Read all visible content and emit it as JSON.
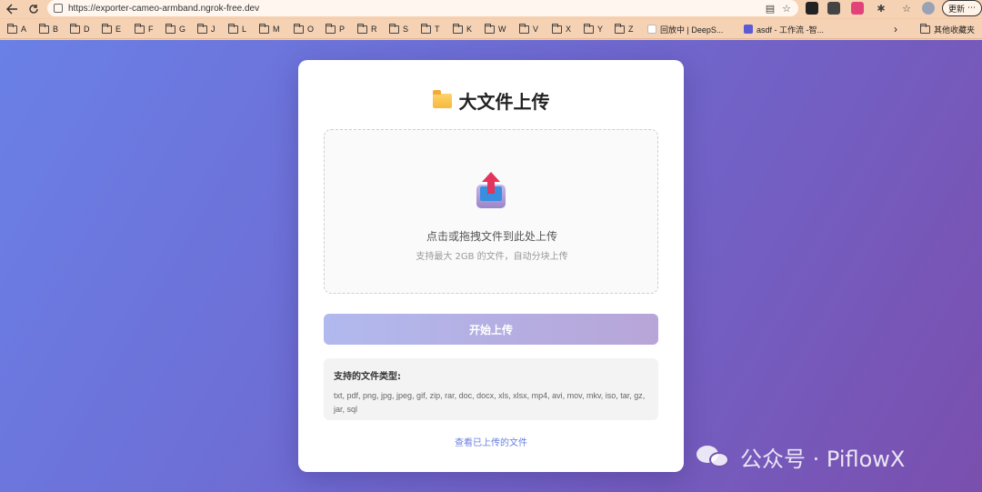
{
  "browser": {
    "url": "https://exporter-cameo-armband.ngrok-free.dev",
    "update_label": "更新",
    "more_label": "⋯"
  },
  "bookmarks": {
    "folders": [
      "A",
      "B",
      "D",
      "E",
      "F",
      "G",
      "J",
      "L",
      "M",
      "O",
      "P",
      "R",
      "S",
      "T",
      "K",
      "W",
      "V",
      "X",
      "Y",
      "Z"
    ],
    "site1": "回放中 | DeepS...",
    "site2": "asdf - 工作流 -智...",
    "other": "其他收藏夹"
  },
  "page": {
    "title": "大文件上传",
    "dropzone_main": "点击或拖拽文件到此处上传",
    "dropzone_sub": "支持最大 2GB 的文件，自动分块上传",
    "start_button": "开始上传",
    "types_title": "支持的文件类型:",
    "types_list": "txt, pdf, png, jpg, jpeg, gif, zip, rar, doc, docx, xls, xlsx, mp4, avi, mov, mkv, iso, tar, gz, jar, sql",
    "view_link": "查看已上传的文件"
  },
  "watermark": {
    "text": "公众号 · PiflowX"
  },
  "colors": {
    "bg_start": "#6a80e6",
    "bg_end": "#7a4fae",
    "button_start": "#b1b9ee",
    "button_end": "#b8a5d8",
    "link": "#6a7fe0"
  }
}
